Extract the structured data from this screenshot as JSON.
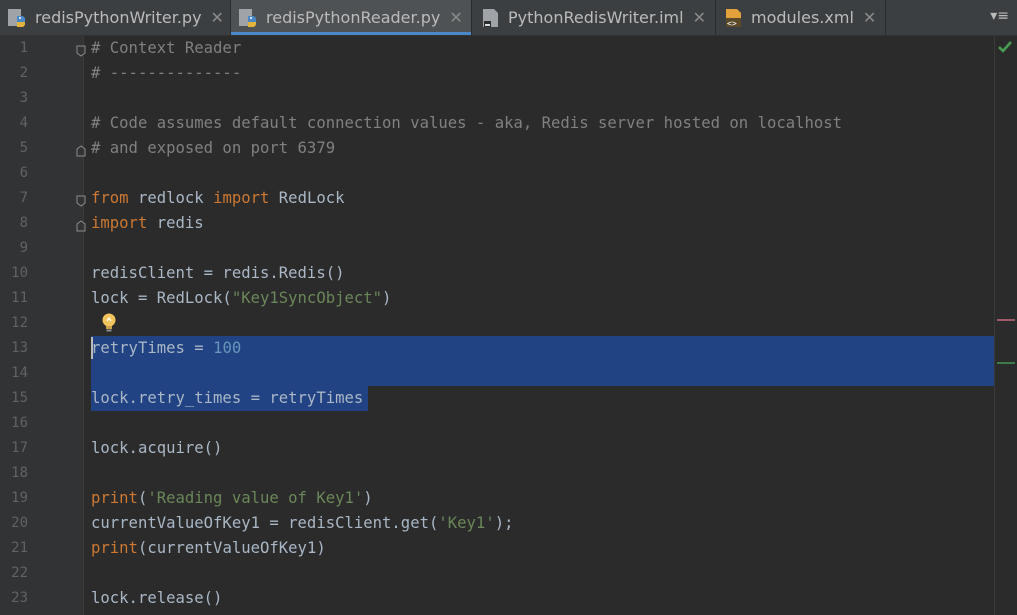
{
  "tabs": [
    {
      "label": "redisPythonWriter.py",
      "icon": "python-file-icon",
      "active": false
    },
    {
      "label": "redisPythonReader.py",
      "icon": "python-file-icon",
      "active": true
    },
    {
      "label": "PythonRedisWriter.iml",
      "icon": "iml-file-icon",
      "active": false
    },
    {
      "label": "modules.xml",
      "icon": "xml-file-icon",
      "active": false
    }
  ],
  "tab_close_glyph": "✕",
  "tab_menu_glyph": "▾≡",
  "lines": [
    {
      "n": "1",
      "tokens": [
        [
          "c",
          "# Context Reader"
        ]
      ]
    },
    {
      "n": "2",
      "tokens": [
        [
          "c",
          "# --------------"
        ]
      ]
    },
    {
      "n": "3",
      "tokens": []
    },
    {
      "n": "4",
      "tokens": [
        [
          "c",
          "# Code assumes default connection values - aka, Redis server hosted on localhost"
        ]
      ]
    },
    {
      "n": "5",
      "tokens": [
        [
          "c",
          "# and exposed on port 6379"
        ]
      ]
    },
    {
      "n": "6",
      "tokens": []
    },
    {
      "n": "7",
      "tokens": [
        [
          "k",
          "from"
        ],
        [
          "p",
          " redlock "
        ],
        [
          "k",
          "import"
        ],
        [
          "p",
          " RedLock"
        ]
      ]
    },
    {
      "n": "8",
      "tokens": [
        [
          "k",
          "import"
        ],
        [
          "p",
          " redis"
        ]
      ]
    },
    {
      "n": "9",
      "tokens": []
    },
    {
      "n": "10",
      "tokens": [
        [
          "p",
          "redisClient = redis.Redis()"
        ]
      ]
    },
    {
      "n": "11",
      "tokens": [
        [
          "p",
          "lock = RedLock("
        ],
        [
          "s",
          "\"Key1SyncObject\""
        ],
        [
          "p",
          ")"
        ]
      ]
    },
    {
      "n": "12",
      "tokens": []
    },
    {
      "n": "13",
      "tokens": [
        [
          "p",
          "retryTimes = "
        ],
        [
          "n",
          "100"
        ]
      ]
    },
    {
      "n": "14",
      "tokens": []
    },
    {
      "n": "15",
      "tokens": [
        [
          "p",
          "lock.retry_times = retryTimes"
        ]
      ]
    },
    {
      "n": "16",
      "tokens": []
    },
    {
      "n": "17",
      "tokens": [
        [
          "p",
          "lock.acquire()"
        ]
      ]
    },
    {
      "n": "18",
      "tokens": []
    },
    {
      "n": "19",
      "tokens": [
        [
          "k",
          "print"
        ],
        [
          "p",
          "("
        ],
        [
          "s",
          "'Reading value of Key1'"
        ],
        [
          "p",
          ")"
        ]
      ]
    },
    {
      "n": "20",
      "tokens": [
        [
          "p",
          "currentValueOfKey1 = redisClient.get("
        ],
        [
          "s",
          "'Key1'"
        ],
        [
          "p",
          ");"
        ]
      ]
    },
    {
      "n": "21",
      "tokens": [
        [
          "k",
          "print"
        ],
        [
          "p",
          "(currentValueOfKey1)"
        ]
      ]
    },
    {
      "n": "22",
      "tokens": []
    },
    {
      "n": "23",
      "tokens": [
        [
          "p",
          "lock.release()"
        ]
      ]
    }
  ],
  "fold_lines": [
    "1",
    "5",
    "7",
    "8"
  ],
  "selection": {
    "start_line": "13",
    "end_line": "15"
  },
  "intention_bulb_line": "12",
  "colors": {
    "comment": "#808080",
    "keyword": "#cc7832",
    "string": "#6a8759",
    "number": "#6897bb",
    "plain": "#a9b7c6",
    "selection": "#214283",
    "check": "#499c54"
  }
}
